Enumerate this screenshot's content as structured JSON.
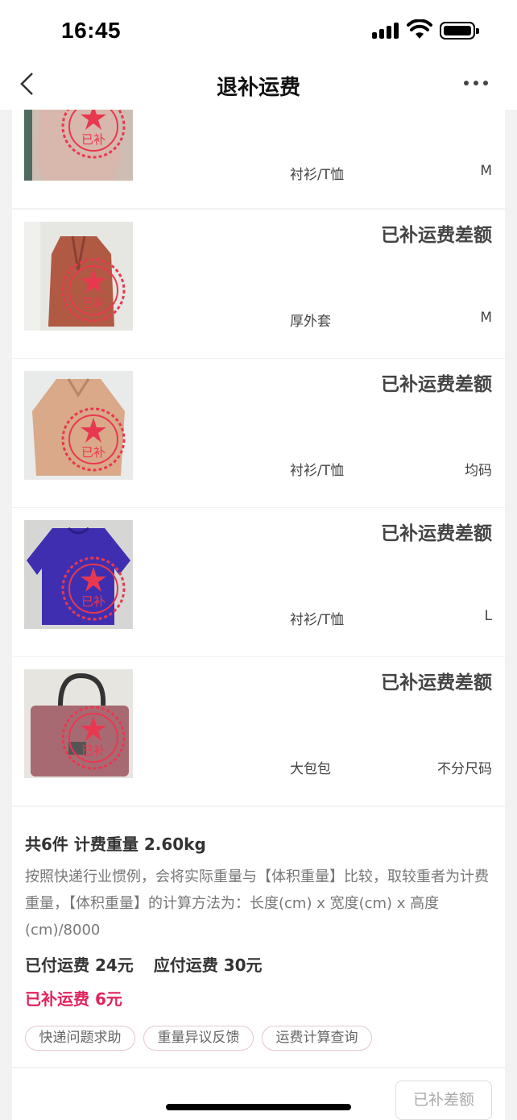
{
  "status_bar": {
    "time": "16:45"
  },
  "nav": {
    "title": "退补运费"
  },
  "items": [
    {
      "title": "",
      "category": "衬衫/T恤",
      "size": "M",
      "stamp_text": "已补"
    },
    {
      "title": "已补运费差额",
      "category": "厚外套",
      "size": "M",
      "stamp_text": "已补"
    },
    {
      "title": "已补运费差额",
      "category": "衬衫/T恤",
      "size": "均码",
      "stamp_text": "已补"
    },
    {
      "title": "已补运费差额",
      "category": "衬衫/T恤",
      "size": "L",
      "stamp_text": "已补"
    },
    {
      "title": "已补运费差额",
      "category": "大包包",
      "size": "不分尺码",
      "stamp_text": "已补"
    }
  ],
  "summary": {
    "count_weight": "共6件 计费重量 2.60kg",
    "description": "按照快递行业惯例，会将实际重量与【体积重量】比较，取较重者为计费重量，【体积重量】的计算方法为：长度(cm) x 宽度(cm) x 高度(cm)/8000",
    "paid": "已付运费 24元",
    "due": "应付运费 30元",
    "supplement": "已补运费 6元",
    "tags": [
      "快递问题求助",
      "重量异议反馈",
      "运费计算查询"
    ]
  },
  "footer": {
    "button_label": "已补差额"
  },
  "colors": {
    "accent": "#e0245e",
    "stamp": "#e8384f"
  }
}
